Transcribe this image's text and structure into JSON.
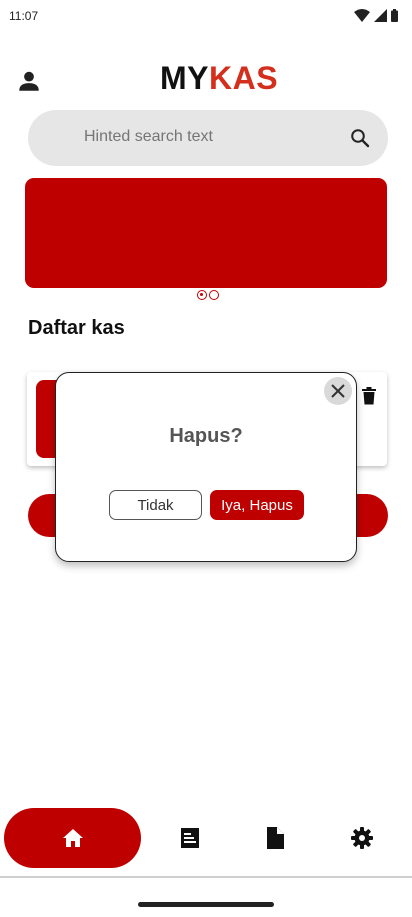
{
  "status_bar": {
    "time": "11:07",
    "icons": [
      "wifi-icon",
      "signal-icon",
      "battery-icon"
    ]
  },
  "header": {
    "logo_part1": "MY",
    "logo_part2": "KAS",
    "profile_icon": "person-icon"
  },
  "search": {
    "placeholder": "Hinted search text",
    "icon": "search-icon"
  },
  "carousel": {
    "pages": 2,
    "active_index": 0
  },
  "section": {
    "title": "Daftar kas"
  },
  "dialog": {
    "title": "Hapus?",
    "cancel_label": "Tidak",
    "confirm_label": "Iya, Hapus",
    "close_icon": "close-icon"
  },
  "bottom_nav": {
    "items": [
      {
        "icon": "home-icon",
        "active": true
      },
      {
        "icon": "receipt-icon",
        "active": false
      },
      {
        "icon": "document-icon",
        "active": false
      },
      {
        "icon": "gear-icon",
        "active": false
      }
    ]
  },
  "colors": {
    "accent": "#bf0000",
    "logo_accent": "#d32f1c",
    "search_bg": "#e6e6e6"
  }
}
